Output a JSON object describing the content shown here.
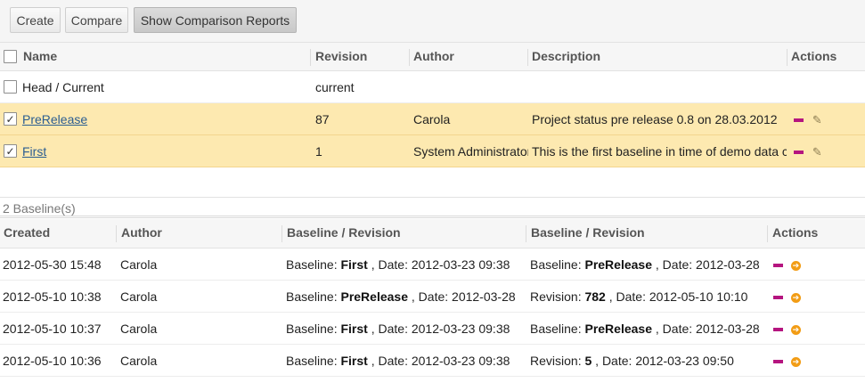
{
  "toolbar": {
    "create_label": "Create",
    "compare_label": "Compare",
    "show_reports_label": "Show Comparison Reports"
  },
  "baselines_table": {
    "headers": {
      "name": "Name",
      "revision": "Revision",
      "author": "Author",
      "description": "Description",
      "actions": "Actions"
    },
    "rows": [
      {
        "name": "Head / Current",
        "revision": "current",
        "author": "",
        "description": "",
        "checked": false,
        "link": false
      },
      {
        "name": "PreRelease",
        "revision": "87",
        "author": "Carola",
        "description": "Project status pre release 0.8 on 28.03.2012",
        "checked": true,
        "link": true
      },
      {
        "name": "First",
        "revision": "1",
        "author": "System Administrator",
        "description": "This is the first baseline in time of demo data creation",
        "checked": true,
        "link": true
      }
    ]
  },
  "summary": {
    "count_text": "2 Baseline(s)"
  },
  "reports_table": {
    "headers": {
      "created": "Created",
      "author": "Author",
      "baseline1": "Baseline / Revision",
      "baseline2": "Baseline / Revision",
      "actions": "Actions"
    },
    "label_baseline": "Baseline:",
    "label_revision": "Revision:",
    "label_date": ", Date:",
    "rows": [
      {
        "created": "2012-05-30 15:48",
        "author": "Carola",
        "left": {
          "kind": "Baseline:",
          "name": "First",
          "date": "2012-03-23 09:38"
        },
        "right": {
          "kind": "Baseline:",
          "name": "PreRelease",
          "date": "2012-03-28"
        }
      },
      {
        "created": "2012-05-10 10:38",
        "author": "Carola",
        "left": {
          "kind": "Baseline:",
          "name": "PreRelease",
          "date": "2012-03-28"
        },
        "right": {
          "kind": "Revision:",
          "name": "782",
          "date": "2012-05-10 10:10"
        }
      },
      {
        "created": "2012-05-10 10:37",
        "author": "Carola",
        "left": {
          "kind": "Baseline:",
          "name": "First",
          "date": "2012-03-23 09:38"
        },
        "right": {
          "kind": "Baseline:",
          "name": "PreRelease",
          "date": "2012-03-28"
        }
      },
      {
        "created": "2012-05-10 10:36",
        "author": "Carola",
        "left": {
          "kind": "Baseline:",
          "name": "First",
          "date": "2012-03-23 09:38"
        },
        "right": {
          "kind": "Revision:",
          "name": "5",
          "date": "2012-03-23 09:50"
        }
      }
    ]
  },
  "icons": {
    "remove": "minus-icon",
    "edit": "pencil-icon",
    "open": "arrow-right-circle-icon"
  },
  "colors": {
    "selected_row": "#fde9b0",
    "remove_icon": "#b5157f",
    "open_icon": "#f29c14",
    "link": "#2a5d91"
  }
}
